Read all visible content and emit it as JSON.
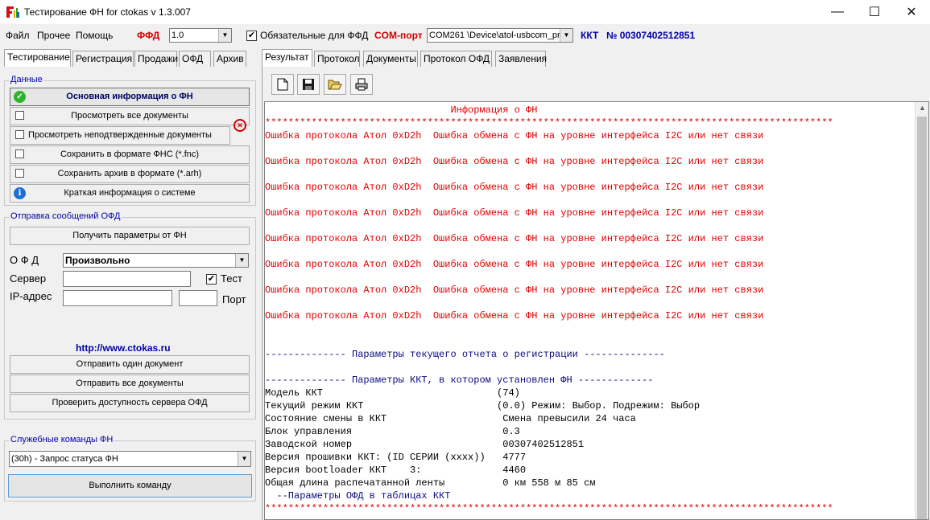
{
  "window": {
    "title": "Тестирование ФН for ctokas  v 1.3.007",
    "minimize": "—",
    "maximize": "☐",
    "close": "✕"
  },
  "menu": {
    "file": "Файл",
    "other": "Прочее",
    "help": "Помощь"
  },
  "ffd": {
    "label": "ФФД",
    "value": "1.0",
    "mandatory_checked": "✔",
    "mandatory_label": "Обязательные для ФФД"
  },
  "com": {
    "label": "COM-порт",
    "value": "COM261 \\Device\\atol-usbcom_pr"
  },
  "kkt": {
    "label": "ККТ",
    "number": "№ 00307402512851"
  },
  "left_tabs": [
    "Тестирование",
    "Регистрация",
    "Продажи",
    "ОФД",
    "Архив"
  ],
  "right_tabs": [
    "Результат",
    "Протокол",
    "Документы",
    "Протокол ОФД",
    "Заявления"
  ],
  "data_group": {
    "title": "Данные",
    "buttons": [
      "Основная информация о ФН",
      "Просмотреть все документы",
      "Просмотреть неподтвержденные документы",
      "Сохранить в формате ФНС  (*.fnc)",
      "Сохранить архив в формате (*.arh)",
      "Краткая информация о системе"
    ]
  },
  "ofd_group": {
    "title": "Отправка сообщений ОФД",
    "get_params": "Получить параметры от ФН",
    "ofd_label": "О Ф Д",
    "ofd_value": "Произвольно",
    "server_label": "Сервер",
    "test_checked": "✔",
    "test_label": "Тест",
    "ip_label": "IP-адрес",
    "port_label": "Порт",
    "link": "http://www.ctokas.ru",
    "send_one": "Отправить один документ",
    "send_all": "Отправить все документы",
    "check_server": "Проверить доступность сервера ОФД"
  },
  "service_group": {
    "title": "Служебные команды ФН",
    "command": "(30h) - Запрос статуса ФН",
    "execute": "Выполнить команду"
  },
  "output": {
    "lines": [
      {
        "t": "                                Информация о ФН",
        "c": "red"
      },
      {
        "t": "**************************************************************************************************",
        "c": "red"
      },
      {
        "t": "Ошибка протокола Атол 0xD2h  Ошибка обмена с ФН на уровне интерфейса I2C или нет связи",
        "c": "red"
      },
      {
        "t": "",
        "c": "red"
      },
      {
        "t": "Ошибка протокола Атол 0xD2h  Ошибка обмена с ФН на уровне интерфейса I2C или нет связи",
        "c": "red"
      },
      {
        "t": "",
        "c": "red"
      },
      {
        "t": "Ошибка протокола Атол 0xD2h  Ошибка обмена с ФН на уровне интерфейса I2C или нет связи",
        "c": "red"
      },
      {
        "t": "",
        "c": "red"
      },
      {
        "t": "Ошибка протокола Атол 0xD2h  Ошибка обмена с ФН на уровне интерфейса I2C или нет связи",
        "c": "red"
      },
      {
        "t": "",
        "c": "red"
      },
      {
        "t": "Ошибка протокола Атол 0xD2h  Ошибка обмена с ФН на уровне интерфейса I2C или нет связи",
        "c": "red"
      },
      {
        "t": "",
        "c": "red"
      },
      {
        "t": "Ошибка протокола Атол 0xD2h  Ошибка обмена с ФН на уровне интерфейса I2C или нет связи",
        "c": "red"
      },
      {
        "t": "",
        "c": "red"
      },
      {
        "t": "Ошибка протокола Атол 0xD2h  Ошибка обмена с ФН на уровне интерфейса I2C или нет связи",
        "c": "red"
      },
      {
        "t": "",
        "c": "red"
      },
      {
        "t": "Ошибка протокола Атол 0xD2h  Ошибка обмена с ФН на уровне интерфейса I2C или нет связи",
        "c": "red"
      },
      {
        "t": "",
        "c": "red"
      },
      {
        "t": "",
        "c": "red"
      },
      {
        "t": "-------------- Параметры текущего отчета о регистрации --------------",
        "c": "navy"
      },
      {
        "t": "",
        "c": "navy"
      },
      {
        "t": "-------------- Параметры ККТ, в котором установлен ФН -------------",
        "c": "navy"
      },
      {
        "t": "Модель ККТ                              (74)",
        "c": "black"
      },
      {
        "t": "Текущий режим ККТ                       (0.0) Режим: Выбор. Подрежим: Выбор",
        "c": "black"
      },
      {
        "t": "Состояние смены в ККТ                    Смена превысили 24 часа",
        "c": "black"
      },
      {
        "t": "Блок управления                          0.3",
        "c": "black"
      },
      {
        "t": "Заводской номер                          00307402512851",
        "c": "black"
      },
      {
        "t": "Версия прошивки ККТ: (ID СЕРИИ (хххх))   4777",
        "c": "black"
      },
      {
        "t": "Версия bootloader ККТ    3:              4460",
        "c": "black"
      },
      {
        "t": "Общая длина распечатанной ленты          0 км 558 м 85 см",
        "c": "black"
      },
      {
        "t": "  --Параметры ОФД в таблицах ККТ",
        "c": "navy"
      },
      {
        "t": "**************************************************************************************************",
        "c": "red"
      }
    ]
  }
}
